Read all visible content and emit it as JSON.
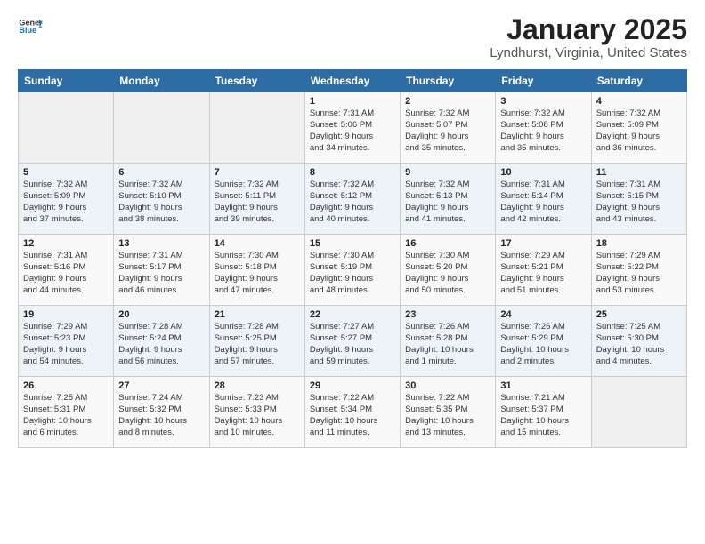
{
  "header": {
    "logo_general": "General",
    "logo_blue": "Blue",
    "month": "January 2025",
    "location": "Lyndhurst, Virginia, United States"
  },
  "days_of_week": [
    "Sunday",
    "Monday",
    "Tuesday",
    "Wednesday",
    "Thursday",
    "Friday",
    "Saturday"
  ],
  "weeks": [
    [
      {
        "day": "",
        "info": ""
      },
      {
        "day": "",
        "info": ""
      },
      {
        "day": "",
        "info": ""
      },
      {
        "day": "1",
        "info": "Sunrise: 7:31 AM\nSunset: 5:06 PM\nDaylight: 9 hours\nand 34 minutes."
      },
      {
        "day": "2",
        "info": "Sunrise: 7:32 AM\nSunset: 5:07 PM\nDaylight: 9 hours\nand 35 minutes."
      },
      {
        "day": "3",
        "info": "Sunrise: 7:32 AM\nSunset: 5:08 PM\nDaylight: 9 hours\nand 35 minutes."
      },
      {
        "day": "4",
        "info": "Sunrise: 7:32 AM\nSunset: 5:09 PM\nDaylight: 9 hours\nand 36 minutes."
      }
    ],
    [
      {
        "day": "5",
        "info": "Sunrise: 7:32 AM\nSunset: 5:09 PM\nDaylight: 9 hours\nand 37 minutes."
      },
      {
        "day": "6",
        "info": "Sunrise: 7:32 AM\nSunset: 5:10 PM\nDaylight: 9 hours\nand 38 minutes."
      },
      {
        "day": "7",
        "info": "Sunrise: 7:32 AM\nSunset: 5:11 PM\nDaylight: 9 hours\nand 39 minutes."
      },
      {
        "day": "8",
        "info": "Sunrise: 7:32 AM\nSunset: 5:12 PM\nDaylight: 9 hours\nand 40 minutes."
      },
      {
        "day": "9",
        "info": "Sunrise: 7:32 AM\nSunset: 5:13 PM\nDaylight: 9 hours\nand 41 minutes."
      },
      {
        "day": "10",
        "info": "Sunrise: 7:31 AM\nSunset: 5:14 PM\nDaylight: 9 hours\nand 42 minutes."
      },
      {
        "day": "11",
        "info": "Sunrise: 7:31 AM\nSunset: 5:15 PM\nDaylight: 9 hours\nand 43 minutes."
      }
    ],
    [
      {
        "day": "12",
        "info": "Sunrise: 7:31 AM\nSunset: 5:16 PM\nDaylight: 9 hours\nand 44 minutes."
      },
      {
        "day": "13",
        "info": "Sunrise: 7:31 AM\nSunset: 5:17 PM\nDaylight: 9 hours\nand 46 minutes."
      },
      {
        "day": "14",
        "info": "Sunrise: 7:30 AM\nSunset: 5:18 PM\nDaylight: 9 hours\nand 47 minutes."
      },
      {
        "day": "15",
        "info": "Sunrise: 7:30 AM\nSunset: 5:19 PM\nDaylight: 9 hours\nand 48 minutes."
      },
      {
        "day": "16",
        "info": "Sunrise: 7:30 AM\nSunset: 5:20 PM\nDaylight: 9 hours\nand 50 minutes."
      },
      {
        "day": "17",
        "info": "Sunrise: 7:29 AM\nSunset: 5:21 PM\nDaylight: 9 hours\nand 51 minutes."
      },
      {
        "day": "18",
        "info": "Sunrise: 7:29 AM\nSunset: 5:22 PM\nDaylight: 9 hours\nand 53 minutes."
      }
    ],
    [
      {
        "day": "19",
        "info": "Sunrise: 7:29 AM\nSunset: 5:23 PM\nDaylight: 9 hours\nand 54 minutes."
      },
      {
        "day": "20",
        "info": "Sunrise: 7:28 AM\nSunset: 5:24 PM\nDaylight: 9 hours\nand 56 minutes."
      },
      {
        "day": "21",
        "info": "Sunrise: 7:28 AM\nSunset: 5:25 PM\nDaylight: 9 hours\nand 57 minutes."
      },
      {
        "day": "22",
        "info": "Sunrise: 7:27 AM\nSunset: 5:27 PM\nDaylight: 9 hours\nand 59 minutes."
      },
      {
        "day": "23",
        "info": "Sunrise: 7:26 AM\nSunset: 5:28 PM\nDaylight: 10 hours\nand 1 minute."
      },
      {
        "day": "24",
        "info": "Sunrise: 7:26 AM\nSunset: 5:29 PM\nDaylight: 10 hours\nand 2 minutes."
      },
      {
        "day": "25",
        "info": "Sunrise: 7:25 AM\nSunset: 5:30 PM\nDaylight: 10 hours\nand 4 minutes."
      }
    ],
    [
      {
        "day": "26",
        "info": "Sunrise: 7:25 AM\nSunset: 5:31 PM\nDaylight: 10 hours\nand 6 minutes."
      },
      {
        "day": "27",
        "info": "Sunrise: 7:24 AM\nSunset: 5:32 PM\nDaylight: 10 hours\nand 8 minutes."
      },
      {
        "day": "28",
        "info": "Sunrise: 7:23 AM\nSunset: 5:33 PM\nDaylight: 10 hours\nand 10 minutes."
      },
      {
        "day": "29",
        "info": "Sunrise: 7:22 AM\nSunset: 5:34 PM\nDaylight: 10 hours\nand 11 minutes."
      },
      {
        "day": "30",
        "info": "Sunrise: 7:22 AM\nSunset: 5:35 PM\nDaylight: 10 hours\nand 13 minutes."
      },
      {
        "day": "31",
        "info": "Sunrise: 7:21 AM\nSunset: 5:37 PM\nDaylight: 10 hours\nand 15 minutes."
      },
      {
        "day": "",
        "info": ""
      }
    ]
  ]
}
